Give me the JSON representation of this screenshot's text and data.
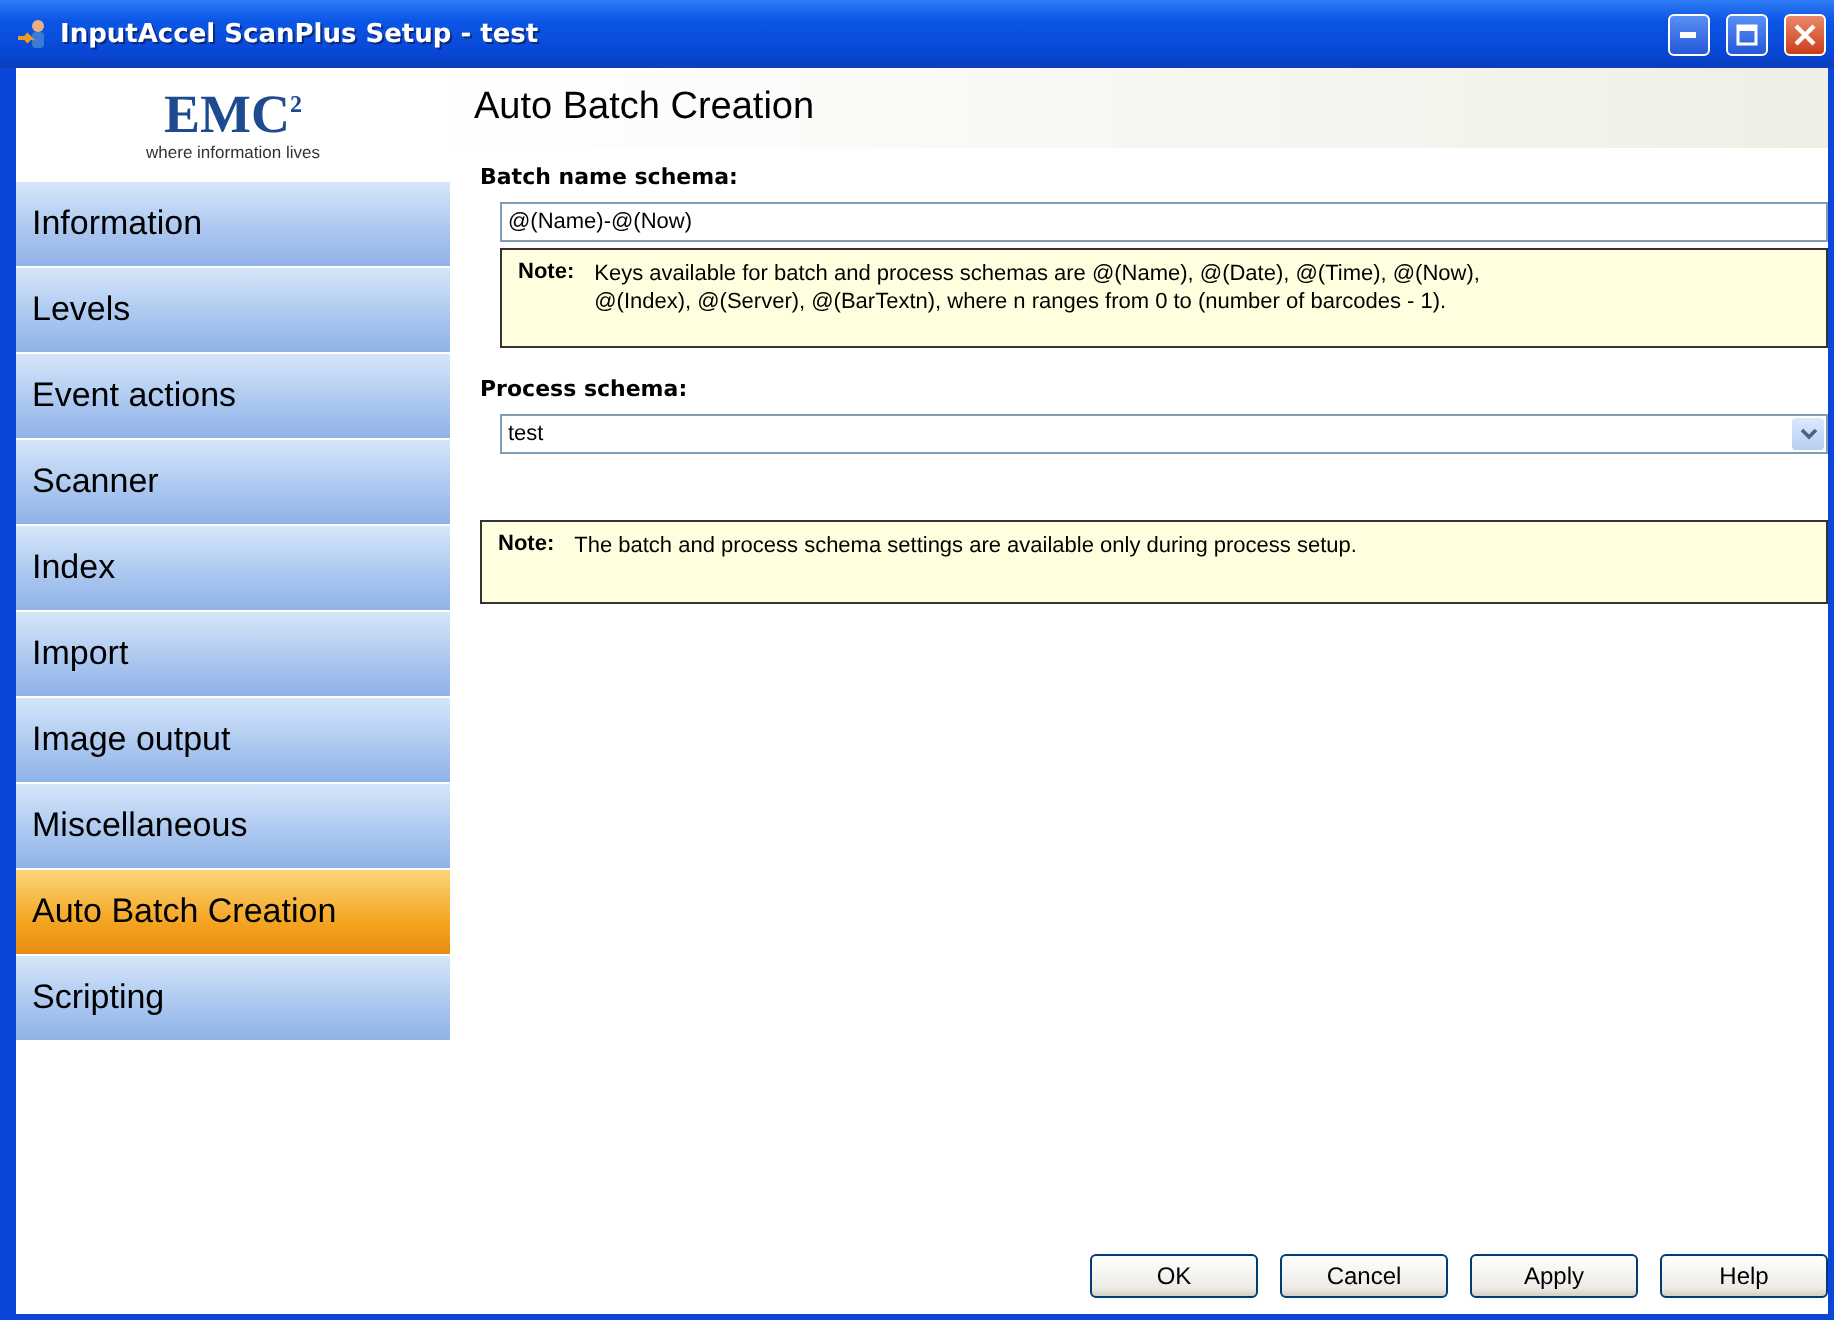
{
  "window": {
    "title": "InputAccel ScanPlus Setup - test"
  },
  "logo": {
    "mark": "EMC$^{2}$",
    "tagline": "where information lives"
  },
  "sidebar": {
    "items": [
      {
        "label": "Information",
        "selected": false
      },
      {
        "label": "Levels",
        "selected": false
      },
      {
        "label": "Event actions",
        "selected": false
      },
      {
        "label": "Scanner",
        "selected": false
      },
      {
        "label": "Index",
        "selected": false
      },
      {
        "label": "Import",
        "selected": false
      },
      {
        "label": "Image output",
        "selected": false
      },
      {
        "label": "Miscellaneous",
        "selected": false
      },
      {
        "label": "Auto Batch Creation",
        "selected": true
      },
      {
        "label": "Scripting",
        "selected": false
      }
    ]
  },
  "page": {
    "title": "Auto Batch Creation",
    "batch_name": {
      "label": "Batch name schema:",
      "value": "@(Name)-@(Now)"
    },
    "note_1": {
      "label": "Note:",
      "lines": [
        "Keys available for batch and process schemas are @(Name), @(Date), @(Time), @(Now),",
        "@(Index), @(Server), @(BarTextn), where n ranges from 0 to (number of barcodes - 1)."
      ]
    },
    "process_schema": {
      "label": "Process schema:",
      "value": "test"
    },
    "note_2": {
      "label": "Note:",
      "lines": [
        "The batch and process schema settings are available only during process setup."
      ]
    }
  },
  "buttons": [
    "OK",
    "Cancel",
    "Apply",
    "Help"
  ]
}
